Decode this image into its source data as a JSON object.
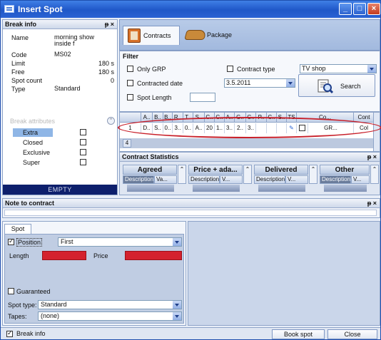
{
  "window": {
    "title": "Insert Spot",
    "buttons": [
      "_",
      "□",
      "×"
    ]
  },
  "break_info": {
    "header": "Break info",
    "header_buttons": "ᵽ ×",
    "fields": [
      {
        "label": "Name",
        "value": "morning show inside f"
      },
      {
        "label": "Code",
        "value": "MS02"
      },
      {
        "label": "Limit",
        "value": "180 s"
      },
      {
        "label": "Free",
        "value": "180 s"
      },
      {
        "label": "Spot count",
        "value": "0"
      },
      {
        "label": "Type",
        "value": "Standard"
      }
    ],
    "attributes_header": "Break attributes",
    "attributes": [
      {
        "label": "Extra",
        "selected": true
      },
      {
        "label": "Closed",
        "selected": false
      },
      {
        "label": "Exclusive",
        "selected": false
      },
      {
        "label": "Super",
        "selected": false
      }
    ],
    "empty_label": "EMPTY"
  },
  "tabs": {
    "contracts": "Contracts",
    "package": "Package"
  },
  "filter": {
    "header": "Filter",
    "only_grp": "Only GRP",
    "contracted_date": "Contracted date",
    "contracted_date_value": "3.5.2011",
    "spot_length": "Spot Length",
    "contract_type": "Contract type",
    "contract_type_value": "TV shop",
    "search": "Search"
  },
  "grid": {
    "headers": [
      "",
      "A..",
      "B..",
      "B..",
      "R..",
      "T..",
      "S..",
      "C..",
      "C..",
      "A..",
      "G..",
      "C..",
      "P..",
      "C..",
      "S..",
      "TS",
      "Co...",
      "Cont"
    ],
    "row": [
      "1",
      "D..",
      "S..",
      "0..",
      "3..",
      "0..",
      "A..",
      "20",
      "1..",
      "3..",
      "2..",
      "3..",
      "",
      "",
      "",
      "",
      "GR...",
      "Col"
    ],
    "footer_count": "4"
  },
  "contract_statistics": {
    "header": "Contract Statistics",
    "header_buttons": "ᵽ ×",
    "groups": [
      {
        "title": "Agreed",
        "sub": [
          "Description",
          "Va..."
        ]
      },
      {
        "title": "Price + ada...",
        "sub": [
          "Description",
          "V..."
        ]
      },
      {
        "title": "Delivered",
        "sub": [
          "Description",
          "V..."
        ]
      },
      {
        "title": "Other",
        "sub": [
          "Description",
          "V..."
        ]
      }
    ]
  },
  "note": {
    "header": "Note to contract",
    "header_buttons": "ᵽ ×"
  },
  "spot": {
    "tab": "Spot",
    "position_label": "Position",
    "position_checked": true,
    "position_value": "First",
    "length_label": "Length",
    "price_label": "Price",
    "length_value": "",
    "price_value": "",
    "guaranteed_label": "Guaranteed",
    "spot_type_label": "Spot type:",
    "spot_type_value": "Standard",
    "tapes_label": "Tapes:",
    "tapes_value": "(none)"
  },
  "bottom": {
    "break_info_checkbox": "Break info",
    "book_spot": "Book spot",
    "close": "Close"
  },
  "colors": {
    "title": "#2a63d3",
    "accent_red": "#d4222e",
    "empty_bar": "#0d1f6c"
  }
}
